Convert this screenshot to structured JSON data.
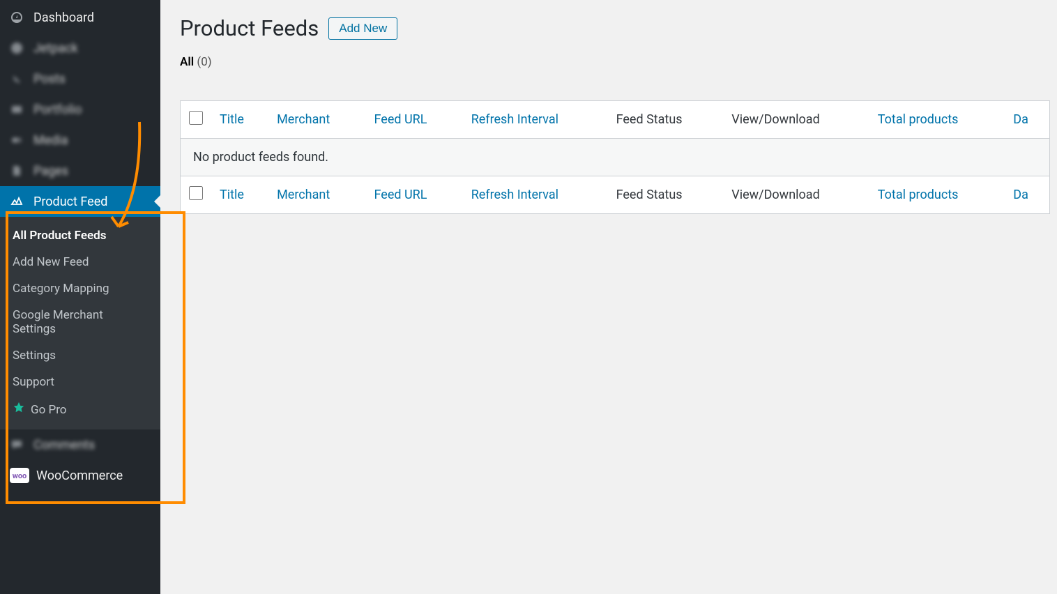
{
  "sidebar": {
    "items": [
      {
        "label": "Dashboard"
      },
      {
        "label": "Jetpack"
      },
      {
        "label": "Posts"
      },
      {
        "label": "Portfolio"
      },
      {
        "label": "Media"
      },
      {
        "label": "Pages"
      },
      {
        "label": "Product Feed"
      },
      {
        "label": "Comments"
      },
      {
        "label": "WooCommerce"
      }
    ],
    "submenu": {
      "all": "All Product Feeds",
      "add_new": "Add New Feed",
      "category": "Category Mapping",
      "google": "Google Merchant Settings",
      "settings": "Settings",
      "support": "Support",
      "go_pro": "Go Pro"
    }
  },
  "page": {
    "title": "Product Feeds",
    "add_new": "Add New",
    "filter_all": "All",
    "filter_count": "(0)"
  },
  "table": {
    "cols": {
      "title": "Title",
      "merchant": "Merchant",
      "feed_url": "Feed URL",
      "refresh": "Refresh Interval",
      "status": "Feed Status",
      "view": "View/Download",
      "total": "Total products",
      "date": "Da"
    },
    "empty": "No product feeds found."
  },
  "woo_badge": "woo"
}
